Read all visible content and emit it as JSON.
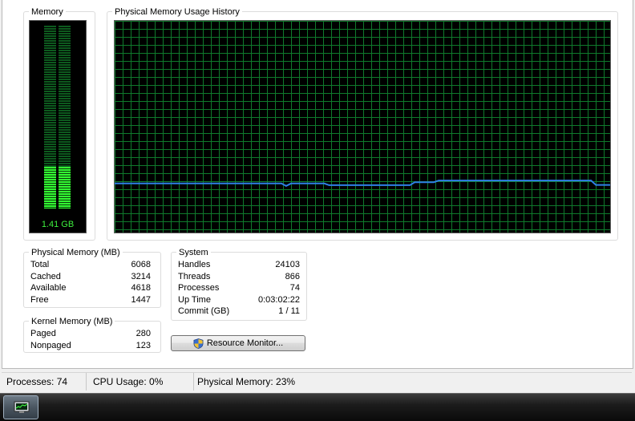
{
  "memory_panel": {
    "title": "Memory",
    "meter_value": "1.41 GB",
    "meter_fill_percent": 23
  },
  "history_panel": {
    "title": "Physical Memory Usage History",
    "usage_history_percent": [
      23.2,
      23.2,
      23.2,
      23.2,
      23.2,
      23.2,
      23.2,
      23.2,
      23.2,
      23.2,
      23.2,
      23.2,
      23.2,
      23.2,
      23.2,
      23.2,
      23.2,
      23.2,
      23.2,
      23.2,
      23.2,
      23.2,
      23.2,
      23.2,
      23.2,
      23.2,
      23.2,
      23.2,
      23.2,
      23.2,
      23.2,
      23.2,
      23.2,
      23.2,
      23.2,
      23.2,
      22.0,
      23.2,
      23.2,
      23.2,
      23.2,
      23.2,
      23.2,
      23.2,
      23.2,
      22.4,
      22.4,
      22.4,
      22.4,
      22.4,
      22.4,
      22.4,
      22.4,
      22.4,
      22.4,
      22.4,
      22.4,
      22.4,
      22.4,
      22.4,
      22.4,
      22.4,
      22.4,
      23.8,
      23.8,
      23.8,
      23.8,
      23.8,
      24.6,
      24.6,
      24.6,
      24.6,
      24.6,
      24.6,
      24.6,
      24.6,
      24.6,
      24.6,
      24.6,
      24.6,
      24.6,
      24.6,
      24.6,
      24.6,
      24.6,
      24.6,
      24.6,
      24.6,
      24.6,
      24.6,
      24.6,
      24.6,
      24.6,
      24.6,
      24.6,
      24.6,
      24.6,
      24.6,
      24.6,
      24.6,
      24.6,
      22.5,
      22.5,
      22.5,
      22.5
    ]
  },
  "physical_memory": {
    "title": "Physical Memory (MB)",
    "rows": [
      {
        "label": "Total",
        "value": "6068"
      },
      {
        "label": "Cached",
        "value": "3214"
      },
      {
        "label": "Available",
        "value": "4618"
      },
      {
        "label": "Free",
        "value": "1447"
      }
    ]
  },
  "kernel_memory": {
    "title": "Kernel Memory (MB)",
    "rows": [
      {
        "label": "Paged",
        "value": "280"
      },
      {
        "label": "Nonpaged",
        "value": "123"
      }
    ]
  },
  "system": {
    "title": "System",
    "rows": [
      {
        "label": "Handles",
        "value": "24103"
      },
      {
        "label": "Threads",
        "value": "866"
      },
      {
        "label": "Processes",
        "value": "74"
      },
      {
        "label": "Up Time",
        "value": "0:03:02:22"
      },
      {
        "label": "Commit (GB)",
        "value": "1 / 11"
      }
    ]
  },
  "resource_monitor_button": {
    "label": "Resource Monitor...",
    "icon": "uac-shield-icon"
  },
  "status_bar": {
    "processes": "Processes: 74",
    "cpu_usage": "CPU Usage: 0%",
    "physical_memory": "Physical Memory: 23%"
  },
  "taskbar": {
    "active_task_icon": "task-manager-icon"
  },
  "colors": {
    "graph_grid": "#0f7a2c",
    "graph_line": "#2f7fe6",
    "meter_fill": "#33ff33",
    "meter_text": "#3ef03e"
  }
}
